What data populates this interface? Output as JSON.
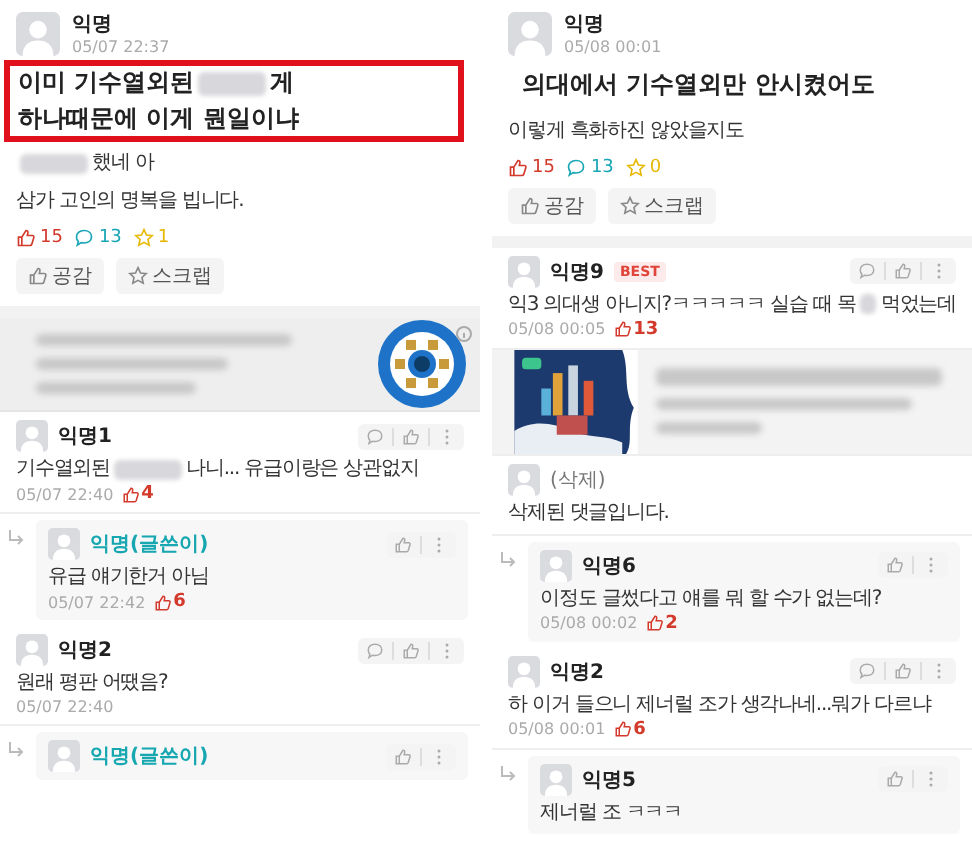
{
  "panels": [
    {
      "post": {
        "author": "익명",
        "time": "05/07 22:37",
        "title_highlighted": true,
        "title_lines": [
          [
            {
              "kind": "text",
              "text": "이미 기수열외된"
            },
            {
              "kind": "redacted"
            },
            {
              "kind": "text",
              "text": "게"
            }
          ],
          [
            {
              "kind": "text",
              "text": "하나때문에 이게 뭔일이냐"
            }
          ]
        ],
        "body_lines": [
          [
            {
              "kind": "redacted"
            },
            {
              "kind": "text",
              "text": "했네 아"
            }
          ],
          [
            {
              "kind": "text",
              "text": "삼가 고인의 명복을 빕니다."
            }
          ]
        ],
        "likes": "15",
        "comments": "13",
        "scraps": "1",
        "actions": [
          "공감",
          "스크랩"
        ]
      },
      "feed": [
        {
          "kind": "ad"
        },
        {
          "kind": "comment",
          "author": "익명1",
          "op": false,
          "best": false,
          "lines": [
            [
              {
                "kind": "text",
                "text": "기수열외된"
              },
              {
                "kind": "redacted"
              },
              {
                "kind": "text",
                "text": "나니... 유급이랑은 상관없지"
              }
            ]
          ],
          "time": "05/07 22:40",
          "likes": "4"
        },
        {
          "kind": "reply",
          "author": "익명(글쓴이)",
          "op": true,
          "best": false,
          "lines": [
            [
              {
                "kind": "text",
                "text": "유급 얘기한거 아님"
              }
            ]
          ],
          "time": "05/07 22:42",
          "likes": "6"
        },
        {
          "kind": "comment",
          "author": "익명2",
          "op": false,
          "best": false,
          "lines": [
            [
              {
                "kind": "text",
                "text": "원래 평판 어땠음?"
              }
            ]
          ],
          "time": "05/07 22:40"
        },
        {
          "kind": "reply",
          "author": "익명(글쓴이)",
          "op": true,
          "best": false
        }
      ]
    },
    {
      "post": {
        "author": "익명",
        "time": "05/08 00:01",
        "title_highlighted": false,
        "title_lines": [
          [
            {
              "kind": "text",
              "text": "의대에서 기수열외만 안시켰어도"
            }
          ]
        ],
        "body_lines": [
          [
            {
              "kind": "text",
              "text": "이렇게 흑화하진 않았을지도"
            }
          ]
        ],
        "likes": "15",
        "comments": "13",
        "scraps": "0",
        "actions": [
          "공감",
          "스크랩"
        ]
      },
      "feed": [
        {
          "kind": "comment",
          "author": "익명9",
          "op": false,
          "best": true,
          "best_label": "BEST",
          "lines": [
            [
              {
                "kind": "text",
                "text": "익3 의대생 아니지?ㅋㅋㅋㅋㅋ 실습 때 목"
              },
              {
                "kind": "redacted"
              },
              {
                "kind": "text",
                "text": "먹었는데"
              }
            ]
          ],
          "time": "05/08 00:05",
          "likes": "13"
        },
        {
          "kind": "link_preview"
        },
        {
          "kind": "deleted",
          "author": "(삭제)",
          "lines": [
            [
              {
                "kind": "text",
                "text": "삭제된 댓글입니다."
              }
            ]
          ]
        },
        {
          "kind": "reply",
          "author": "익명6",
          "op": false,
          "best": false,
          "lines": [
            [
              {
                "kind": "text",
                "text": "이정도 글썼다고 얘를 뭐 할 수가 없는데?"
              }
            ]
          ],
          "time": "05/08 00:02",
          "likes": "2"
        },
        {
          "kind": "comment",
          "author": "익명2",
          "op": false,
          "best": false,
          "lines": [
            [
              {
                "kind": "text",
                "text": "하 이거 들으니 제너럴 조가 생각나네...뭐가 다르냐"
              }
            ]
          ],
          "time": "05/08 00:01",
          "likes": "6"
        },
        {
          "kind": "reply",
          "author": "익명5",
          "op": false,
          "best": false,
          "lines": [
            [
              {
                "kind": "text",
                "text": "제너럴 조 ㅋㅋㅋ"
              }
            ]
          ]
        }
      ]
    }
  ]
}
